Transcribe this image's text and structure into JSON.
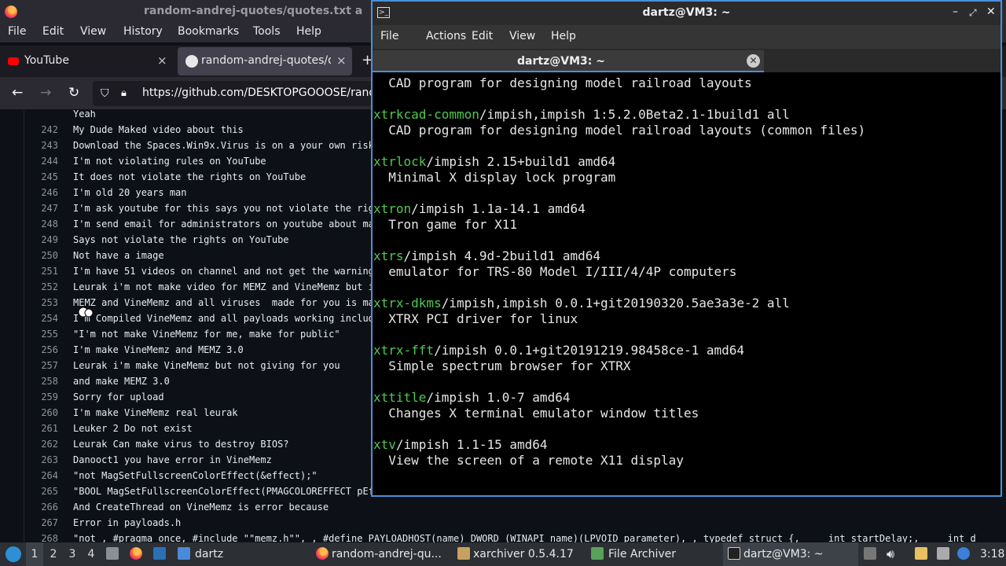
{
  "firefox": {
    "title": "random-andrej-quotes/quotes.txt a",
    "menu": [
      "File",
      "Edit",
      "View",
      "History",
      "Bookmarks",
      "Tools",
      "Help"
    ],
    "tabs": [
      {
        "label": "YouTube",
        "close": "×"
      },
      {
        "label": "random-andrej-quotes/quo",
        "close": "×"
      }
    ],
    "new_tab": "+",
    "nav": {
      "back": "←",
      "forward": "→",
      "reload": "↻"
    },
    "url": "https://github.com/DESKTOPGOOOSE/rand",
    "code_lines": [
      {
        "n": "",
        "t": "Yeah"
      },
      {
        "n": "242",
        "t": "My Dude Maked video about this"
      },
      {
        "n": "243",
        "t": "Download the Spaces.Win9x.Virus is on a your own risk"
      },
      {
        "n": "244",
        "t": "I'm not violating rules on YouTube"
      },
      {
        "n": "245",
        "t": "It does not violate the rights on YouTube"
      },
      {
        "n": "246",
        "t": "I'm old 20 years man"
      },
      {
        "n": "247",
        "t": "I'm ask youtube for this says you not violate the rig"
      },
      {
        "n": "248",
        "t": "I'm send email for administrators on youtube about ma"
      },
      {
        "n": "249",
        "t": "Says not violate the rights on YouTube"
      },
      {
        "n": "250",
        "t": "Not have a image"
      },
      {
        "n": "251",
        "t": "I'm have 51 videos on channel and not get the warning"
      },
      {
        "n": "252",
        "t": "Leurak i'm not make video for MEMZ and VineMemz but i"
      },
      {
        "n": "253",
        "t": "MEMZ and VineMemz and all viruses  made for you is ma"
      },
      {
        "n": "254",
        "t": "I'm Compiled VineMemz and all payloads working includ"
      },
      {
        "n": "255",
        "t": "\"I'm not make VineMemz for me, make for public\""
      },
      {
        "n": "256",
        "t": "I'm make VineMemz and MEMZ 3.0"
      },
      {
        "n": "257",
        "t": "Leurak i'm make VineMemz but not giving for you"
      },
      {
        "n": "258",
        "t": "and make MEMZ 3.0"
      },
      {
        "n": "259",
        "t": "Sorry for upload"
      },
      {
        "n": "260",
        "t": "I'm make VineMemz real leurak"
      },
      {
        "n": "261",
        "t": "Leuker 2 Do not exist"
      },
      {
        "n": "262",
        "t": "Leurak Can make virus to destroy BIOS?"
      },
      {
        "n": "263",
        "t": "Danooct1 you have error in VineMemz"
      },
      {
        "n": "264",
        "t": "\"not MagSetFullscreenColorEffect(&effect);\""
      },
      {
        "n": "265",
        "t": "\"BOOL MagSetFullscreenColorEffect(PMAGCOLOREFFECT pEf"
      },
      {
        "n": "266",
        "t": "And CreateThread on VineMemz is error because"
      },
      {
        "n": "267",
        "t": "Error in payloads.h"
      },
      {
        "n": "268",
        "t": "\"not , #pragma once, #include \"\"memz.h\"\", , #define PAYLOADHOST(name) DWORD (WINAPI name)(LPVOID parameter), , typedef struct {,     int startDelay;,     int d"
      }
    ]
  },
  "terminal": {
    "title": "dartz@VM3: ~",
    "menu": [
      "File",
      "Actions",
      "Edit",
      "View",
      "Help"
    ],
    "tab_label": "dartz@VM3: ~",
    "lines": [
      {
        "pkg": "",
        "rest": "  CAD program for designing model railroad layouts"
      },
      {
        "pkg": "",
        "rest": ""
      },
      {
        "pkg": "xtrkcad-common",
        "rest": "/impish,impish 1:5.2.0Beta2.1-1build1 all"
      },
      {
        "pkg": "",
        "rest": "  CAD program for designing model railroad layouts (common files)"
      },
      {
        "pkg": "",
        "rest": ""
      },
      {
        "pkg": "xtrlock",
        "rest": "/impish 2.15+build1 amd64"
      },
      {
        "pkg": "",
        "rest": "  Minimal X display lock program"
      },
      {
        "pkg": "",
        "rest": ""
      },
      {
        "pkg": "xtron",
        "rest": "/impish 1.1a-14.1 amd64"
      },
      {
        "pkg": "",
        "rest": "  Tron game for X11"
      },
      {
        "pkg": "",
        "rest": ""
      },
      {
        "pkg": "xtrs",
        "rest": "/impish 4.9d-2build1 amd64"
      },
      {
        "pkg": "",
        "rest": "  emulator for TRS-80 Model I/III/4/4P computers"
      },
      {
        "pkg": "",
        "rest": ""
      },
      {
        "pkg": "xtrx-dkms",
        "rest": "/impish,impish 0.0.1+git20190320.5ae3a3e-2 all"
      },
      {
        "pkg": "",
        "rest": "  XTRX PCI driver for linux"
      },
      {
        "pkg": "",
        "rest": ""
      },
      {
        "pkg": "xtrx-fft",
        "rest": "/impish 0.0.1+git20191219.98458ce-1 amd64"
      },
      {
        "pkg": "",
        "rest": "  Simple spectrum browser for XTRX"
      },
      {
        "pkg": "",
        "rest": ""
      },
      {
        "pkg": "xttitle",
        "rest": "/impish 1.0-7 amd64"
      },
      {
        "pkg": "",
        "rest": "  Changes X terminal emulator window titles"
      },
      {
        "pkg": "",
        "rest": ""
      },
      {
        "pkg": "xtv",
        "rest": "/impish 1.1-15 amd64"
      },
      {
        "pkg": "",
        "rest": "  View the screen of a remote X11 display"
      }
    ]
  },
  "taskbar": {
    "workspaces": [
      "1",
      "2",
      "3",
      "4"
    ],
    "folder_label": "dartz",
    "items": [
      {
        "label": "random-andrej-qu..."
      },
      {
        "label": "xarchiver 0.5.4.17"
      },
      {
        "label": "File Archiver"
      },
      {
        "label": "dartz@VM3: ~"
      }
    ],
    "clock": "3:18"
  }
}
